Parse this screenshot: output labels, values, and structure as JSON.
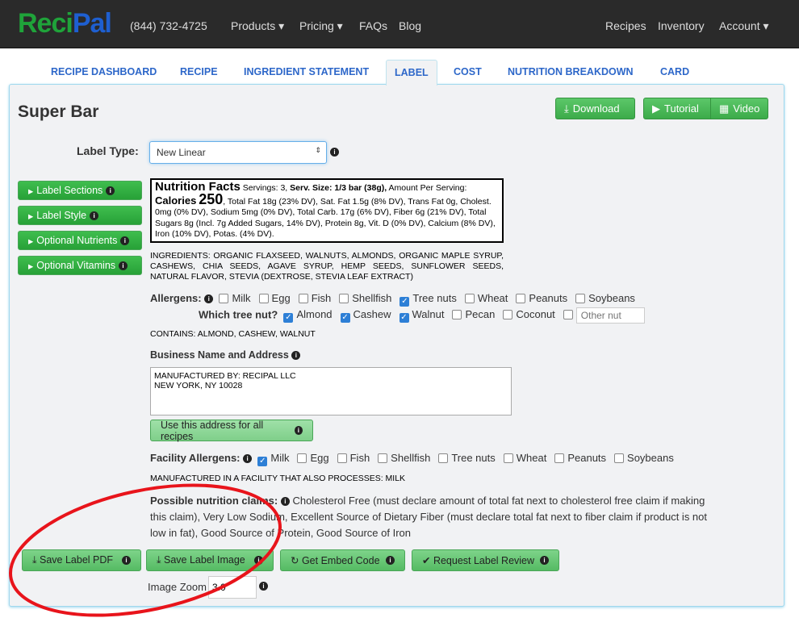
{
  "nav": {
    "logo_a": "Reci",
    "logo_b": "Pal",
    "phone": "(844) 732-4725",
    "products": "Products ▾",
    "pricing": "Pricing ▾",
    "faqs": "FAQs",
    "blog": "Blog",
    "recipes": "Recipes",
    "inventory": "Inventory",
    "account": "Account ▾"
  },
  "tabs": [
    "RECIPE DASHBOARD",
    "RECIPE",
    "INGREDIENT STATEMENT",
    "LABEL",
    "COST",
    "NUTRITION BREAKDOWN",
    "CARD"
  ],
  "title": "Super Bar",
  "download": "Download",
  "tutorial": "Tutorial",
  "video": "Video",
  "label_type_label": "Label Type:",
  "label_type_value": "New Linear",
  "side": [
    "Label Sections",
    "Label Style",
    "Optional Nutrients",
    "Optional Vitamins"
  ],
  "nf": {
    "head": "Nutrition Facts",
    "servings": "Servings: 3,",
    "serv_size": "Serv. Size: 1/3 bar (38g),",
    "amount": "Amount Per Serving:",
    "calories": "Calories",
    "cal_val": "250",
    "rest": ", Total Fat 18g (23% DV), Sat. Fat 1.5g (8% DV), Trans Fat 0g, Cholest. 0mg (0% DV), Sodium 5mg (0% DV), Total Carb. 17g (6% DV), Fiber 6g (21% DV), Total Sugars 8g (Incl. 7g Added Sugars, 14% DV), Protein 8g, Vit. D (0% DV), Calcium (8% DV), Iron (10% DV), Potas. (4% DV)."
  },
  "ingredients": "INGREDIENTS: ORGANIC FLAXSEED, WALNUTS, ALMONDS, ORGANIC MAPLE SYRUP, CASHEWS, CHIA SEEDS, AGAVE SYRUP, HEMP SEEDS, SUNFLOWER SEEDS, NATURAL FLAVOR, STEVIA (DEXTROSE, STEVIA LEAF EXTRACT)",
  "allergens_label": "Allergens:",
  "allergens": [
    {
      "l": "Milk",
      "c": false
    },
    {
      "l": "Egg",
      "c": false
    },
    {
      "l": "Fish",
      "c": false
    },
    {
      "l": "Shellfish",
      "c": false
    },
    {
      "l": "Tree nuts",
      "c": true
    },
    {
      "l": "Wheat",
      "c": false
    },
    {
      "l": "Peanuts",
      "c": false
    },
    {
      "l": "Soybeans",
      "c": false
    }
  ],
  "tree_nut_label": "Which tree nut?",
  "tree_nuts": [
    {
      "l": "Almond",
      "c": true
    },
    {
      "l": "Cashew",
      "c": true
    },
    {
      "l": "Walnut",
      "c": true
    },
    {
      "l": "Pecan",
      "c": false
    },
    {
      "l": "Coconut",
      "c": false
    }
  ],
  "other_nut_placeholder": "Other nut",
  "contains": "CONTAINS: ALMOND, CASHEW, WALNUT",
  "business_label": "Business Name and Address",
  "business_value": "MANUFACTURED BY: RECIPAL LLC\nNEW YORK, NY 10028",
  "use_address": "Use this address for all recipes",
  "facility_label": "Facility Allergens:",
  "facility": [
    {
      "l": "Milk",
      "c": true
    },
    {
      "l": "Egg",
      "c": false
    },
    {
      "l": "Fish",
      "c": false
    },
    {
      "l": "Shellfish",
      "c": false
    },
    {
      "l": "Tree nuts",
      "c": false
    },
    {
      "l": "Wheat",
      "c": false
    },
    {
      "l": "Peanuts",
      "c": false
    },
    {
      "l": "Soybeans",
      "c": false
    }
  ],
  "facility_statement": "MANUFACTURED IN A FACILITY THAT ALSO PROCESSES: MILK",
  "claims_label": "Possible nutrition claims:",
  "claims": "Cholesterol Free (must declare amount of total fat next to cholesterol free claim if making this claim), Very Low Sodium, Excellent Source of Dietary Fiber (must declare total fat next to fiber claim if product is not low in fat), Good Source of Protein, Good Source of Iron",
  "buttons": {
    "pdf": "Save Label PDF",
    "image": "Save Label Image",
    "embed": "Get Embed Code",
    "review": "Request Label Review"
  },
  "zoom_label": "Image Zoom",
  "zoom_value": "3.0"
}
